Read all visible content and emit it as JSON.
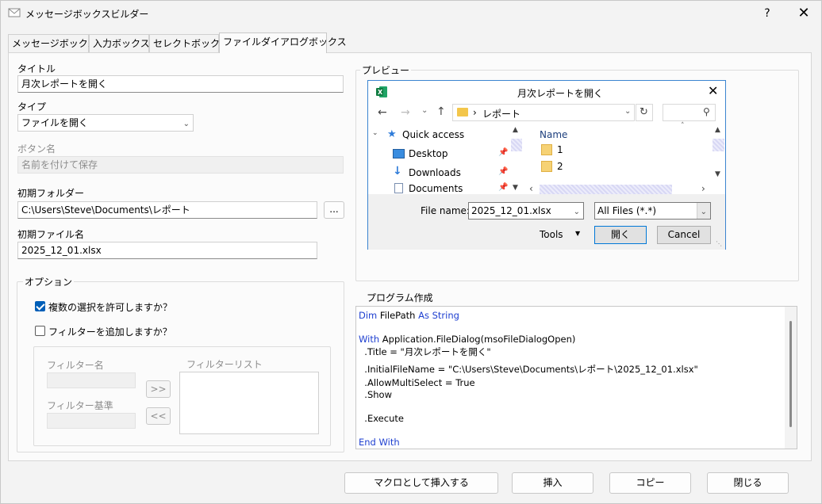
{
  "window": {
    "title": "メッセージボックスビルダー",
    "help": "?",
    "close": "✕"
  },
  "tabs": [
    "メッセージボックス",
    "入力ボックス",
    "セレクトボックス",
    "ファイルダイアログボックス"
  ],
  "form": {
    "title_label": "タイトル",
    "title_value": "月次レポートを開く",
    "type_label": "タイプ",
    "type_value": "ファイルを開く",
    "button_label": "ボタン名",
    "button_value": "名前を付けて保存",
    "folder_label": "初期フォルダー",
    "folder_value": "C:\\Users\\Steve\\Documents\\レポート",
    "browse": "...",
    "file_label": "初期ファイル名",
    "file_value": "2025_12_01.xlsx"
  },
  "options": {
    "title": "オプション",
    "multi_label": "複数の選択を許可しますか？",
    "filter_label": "フィルターを追加しますか？",
    "filter_name_label": "フィルター名",
    "filter_criteria_label": "フィルター基準",
    "filter_list_label": "フィルターリスト",
    "add": ">>",
    "remove": "<<"
  },
  "preview": {
    "group_title": "プレビュー",
    "dialog_title": "月次レポートを開く",
    "path": "レポート",
    "nav": [
      {
        "label": "Quick access"
      },
      {
        "label": "Desktop"
      },
      {
        "label": "Downloads"
      },
      {
        "label": "Documents"
      }
    ],
    "col_name": "Name",
    "files": [
      "1",
      "2"
    ],
    "filename_label": "File name:",
    "filename_value": "2025_12_01.xlsx",
    "filter_value": "All Files (*.*)",
    "tools": "Tools",
    "open": "開く",
    "cancel": "Cancel"
  },
  "code": {
    "group_title": "プログラム作成",
    "l1a": "Dim ",
    "l1b": "FilePath ",
    "l1c": "As String",
    "l2a": "With ",
    "l2b": "Application.FileDialog(msoFileDialogOpen)",
    "l3": "  .Title = \"月次レポートを開く\"",
    "l4": "  .InitialFileName = \"C:\\Users\\Steve\\Documents\\レポート\\2025_12_01.xlsx\"",
    "l5": "  .AllowMultiSelect = True",
    "l6": "  .Show",
    "l7": "  .Execute",
    "l8": "End With"
  },
  "buttons": {
    "macro": "マクロとして挿入する",
    "insert": "挿入",
    "copy": "コピー",
    "close": "閉じる"
  }
}
